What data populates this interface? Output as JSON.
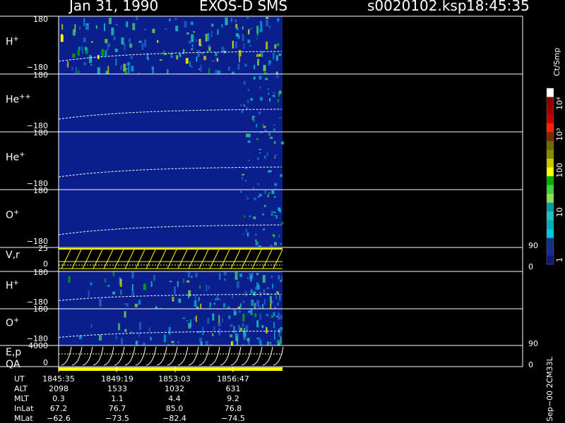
{
  "header": {
    "date": "Jan 31, 1990",
    "instrument": "EXOS-D SMS",
    "file": "s0020102.ksp",
    "time": "18:45:35"
  },
  "panels": [
    {
      "id": "h_plus_top",
      "species": "H",
      "charge": "+",
      "ytop": "180",
      "ybot": "−180"
    },
    {
      "id": "he_pp",
      "species": "He",
      "charge": "++",
      "ytop": "180",
      "ybot": "−180"
    },
    {
      "id": "he_plus",
      "species": "He",
      "charge": "+",
      "ytop": "180",
      "ybot": "−180"
    },
    {
      "id": "o_plus_top",
      "species": "O",
      "charge": "+",
      "ytop": "180",
      "ybot": "−180"
    },
    {
      "id": "vr",
      "species": "V,r",
      "charge": "",
      "ytop": "25",
      "ybot": "0",
      "rtop": "90",
      "rbot": "0"
    },
    {
      "id": "h_plus_bot",
      "species": "H",
      "charge": "+",
      "ytop": "180",
      "ybot": "−180"
    },
    {
      "id": "o_plus_bot",
      "species": "O",
      "charge": "+",
      "ytop": "180",
      "ybot": "−180"
    },
    {
      "id": "ep",
      "species": "E,p",
      "charge": "",
      "ytop": "4000",
      "ybot": "0",
      "rtop": "90",
      "rbot": "0"
    }
  ],
  "qa_label": "QA",
  "colorbar": {
    "unit": "Ct/Smp",
    "labels": [
      "10⁴",
      "10³",
      "100",
      "10",
      "1"
    ],
    "colors": [
      "#ffffff",
      "#8b0000",
      "#a00000",
      "#cc0000",
      "#ff2000",
      "#7a2a00",
      "#6b6b00",
      "#8b8b00",
      "#c8c800",
      "#ffff00",
      "#00b000",
      "#40d040",
      "#90e050",
      "#00a0a0",
      "#20c0c0",
      "#00b0b0",
      "#00c8e0",
      "#103080",
      "#1a2a9a",
      "#101870"
    ]
  },
  "ephemeris": {
    "row_labels": [
      "UT",
      "ALT",
      "MLT",
      "InLat",
      "MLat"
    ],
    "columns": [
      [
        "1845:35",
        "2098",
        "0.3",
        "67.2",
        "−62.6"
      ],
      [
        "1849:19",
        "1533",
        "1.1",
        "76.7",
        "−73.5"
      ],
      [
        "1853:03",
        "1032",
        "4.4",
        "85.0",
        "−82.4"
      ],
      [
        "1856:47",
        "631",
        "9.2",
        "76.8",
        "−74.5"
      ]
    ]
  },
  "footer_note": "Sep−00 2CM33L",
  "chart_data": {
    "type": "heatmap",
    "x_ticks": [
      "1845:35",
      "1849:19",
      "1853:03",
      "1856:47"
    ],
    "y_range_pitch": [
      -180,
      180
    ],
    "v_range": [
      0,
      25
    ],
    "e_range": [
      0,
      4000
    ],
    "colorscale_range": [
      1,
      10000
    ],
    "colorscale_unit": "Ct/Smp"
  }
}
